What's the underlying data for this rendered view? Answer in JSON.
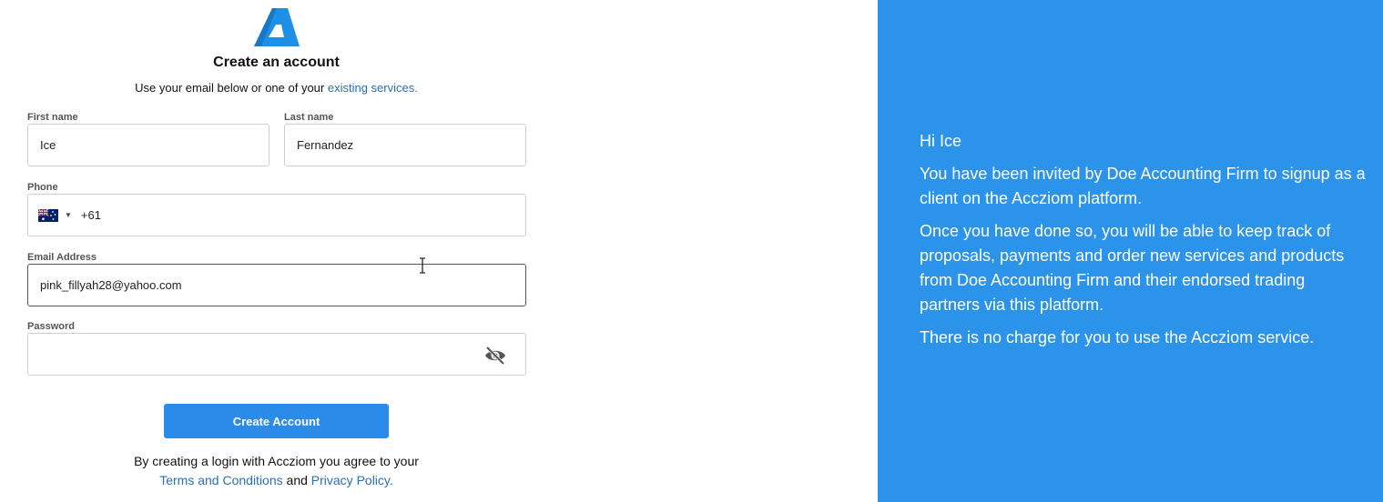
{
  "form": {
    "title": "Create an account",
    "subtitle_prefix": "Use your email below or one of your ",
    "subtitle_link": "existing services.",
    "first_name": {
      "label": "First name",
      "value": "Ice"
    },
    "last_name": {
      "label": "Last name",
      "value": "Fernandez"
    },
    "phone": {
      "label": "Phone",
      "value": "+61",
      "country_flag": "australia-flag-icon"
    },
    "email": {
      "label": "Email Address",
      "value": "pink_fillyah28@yahoo.com"
    },
    "password": {
      "label": "Password",
      "value": "",
      "toggle_icon": "eye-off-icon"
    },
    "submit_label": "Create Account",
    "legal_prefix": "By creating a login with Accziom you agree to your",
    "terms_link": "Terms and Conditions",
    "and_text": "and",
    "privacy_link": "Privacy Policy."
  },
  "panel": {
    "greeting": "Hi Ice",
    "paragraph1": "You have been invited by Doe Accounting Firm to signup as a client on the Accziom platform.",
    "paragraph2": "Once you have done so, you will be able to keep track of proposals, payments and order new services and products from Doe Accounting Firm and their endorsed trading partners via this platform.",
    "paragraph3": "There is no charge for you to use the Accziom service."
  },
  "colors": {
    "brand": "#2b93ea",
    "button": "#2b8be8",
    "link": "#2a6fb5"
  }
}
